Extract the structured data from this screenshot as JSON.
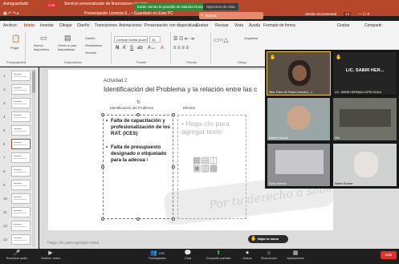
{
  "titlebar": {
    "autosave": "Autoguardado",
    "rec": "LIVE",
    "doc_title_left": "Servicio personalizado de financiacion en voce...",
    "doc_title": "Presentación Licencia 9... • Guardado en Este PC",
    "zoom_share_banner": "Estás viendo la pantalla de Mariela Roman",
    "zoom_view_options": "Opciones de vista",
    "search": "Buscar",
    "session": "Sesión Documental",
    "account_badge": "13"
  },
  "tabs": [
    "Archivo",
    "Inicio",
    "Insertar",
    "Dibujar",
    "Diseño",
    "Transiciones",
    "Animaciones",
    "Presentación con diapositivas",
    "Grabar",
    "Revisar",
    "Vista",
    "Ayuda",
    "Formato de forma"
  ],
  "tabs_active": "Inicio",
  "tabs_right": [
    "Grabar",
    "Compartir"
  ],
  "ribbon": {
    "paste": "Pegar",
    "new_slide": "Nueva diapositiva",
    "reuse": "Volver a usar diapositivas",
    "layout": "Diseño",
    "reset": "Restablecer",
    "section": "Sección",
    "font": "Century Gothic (Cuerpo)",
    "font_size": "16",
    "arrange": "Organizar",
    "quick_styles": "Estilos rápidos",
    "find": "Buscar",
    "replace": "Reemplazar",
    "select": "Seleccionar",
    "dictate": "Dictar",
    "designer": "Diseñador",
    "groups": {
      "clipboard": "Portapapeles",
      "slides": "Diapositivas",
      "font": "Fuente",
      "paragraph": "Párrafo",
      "drawing": "Dibujo",
      "editing": "Edición",
      "voice": "Voz"
    }
  },
  "thumbnails": [
    "1",
    "2",
    "3",
    "4",
    "5",
    "6",
    "7",
    "8",
    "9",
    "10",
    "11",
    "12",
    "13"
  ],
  "selected_slide": "6",
  "slide": {
    "activity": "Actividad 2",
    "title": "Identificación del Problema  y la relación entre las c",
    "col_left": "Identificación del Problema",
    "col_right": "Efectos",
    "bullet_1": "Falta de capacitación y profesionalización de los RAT. (ICES)",
    "bullet_2": "Falta de presupuesto designado o etiquetado para la adecua",
    "placeholder": "Haga clic para agregar texto",
    "watermark": "Por tu derecho a saber"
  },
  "notes_placeholder": "Haga clic para agregar notas",
  "participants": [
    {
      "name": "Mtra. Ester De Paola Crezcini (...)",
      "speaker": true
    },
    {
      "name": "LIC. SABIR HERNAN LOPEZ AVILA",
      "big": "LIC. SABIR HER...",
      "speaker": false
    },
    {
      "name": "Mariela Roman",
      "speaker": false
    },
    {
      "name": "Ditz",
      "speaker": false
    },
    {
      "name": "Gaby Ernesto",
      "speaker": false
    },
    {
      "name": "Martin Rocher",
      "speaker": false
    }
  ],
  "zoom_bar": {
    "mute": "Reactivar audio",
    "video": "Detener video",
    "participants": "Participantes",
    "participants_count": "215",
    "chat": "Chat",
    "share": "Compartir pantalla",
    "record": "Grabar",
    "reactions": "Reacciones",
    "apps": "Aplicaciones",
    "leave": "Salir",
    "raise_hand": "Bajar la mano"
  }
}
